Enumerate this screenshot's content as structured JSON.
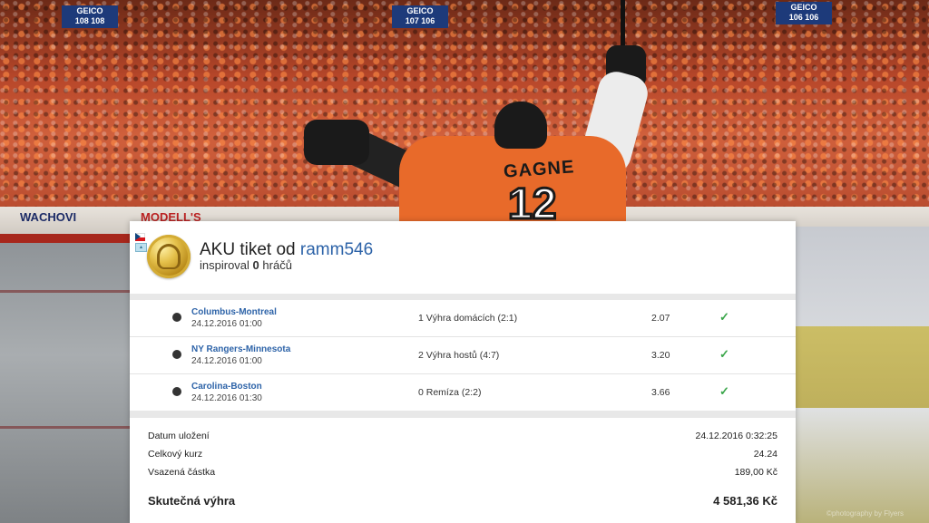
{
  "background": {
    "ads": {
      "geico_1": "GEICO",
      "geico_1_nums": "108 108",
      "geico_2": "GEICO",
      "geico_2_nums": "107 106",
      "geico_3": "GEICO",
      "geico_3_nums": "106 106",
      "wachovia": "WACHOVI",
      "modells": "MODELL'S"
    },
    "player": {
      "name": "GAGNE",
      "number": "12"
    },
    "watermark": "©photography by Flyers"
  },
  "ticket": {
    "flag": "cz-flag",
    "badge_icon": "gold-coin-icon",
    "title_prefix": "AKU tiket od",
    "username": "ramm546",
    "subtitle_prefix": "inspiroval",
    "subtitle_count": "0",
    "subtitle_suffix": "hráčů",
    "bets": [
      {
        "match": "Columbus-Montreal",
        "date": "24.12.2016 01:00",
        "tip": "1 Výhra domácích (2:1)",
        "odds": "2.07",
        "status": "✓"
      },
      {
        "match": "NY Rangers-Minnesota",
        "date": "24.12.2016 01:00",
        "tip": "2 Výhra hostů (4:7)",
        "odds": "3.20",
        "status": "✓"
      },
      {
        "match": "Carolina-Boston",
        "date": "24.12.2016 01:30",
        "tip": "0 Remíza (2:2)",
        "odds": "3.66",
        "status": "✓"
      }
    ],
    "summary": {
      "saved_label": "Datum uložení",
      "saved_value": "24.12.2016 0:32:25",
      "total_odds_label": "Celkový kurz",
      "total_odds_value": "24.24",
      "stake_label": "Vsazená částka",
      "stake_value": "189,00 Kč",
      "win_label": "Skutečná výhra",
      "win_value": "4 581,36 Kč"
    }
  },
  "colors": {
    "link": "#2d63a8",
    "success": "#3aa64a",
    "separator": "#e8e8e8"
  }
}
